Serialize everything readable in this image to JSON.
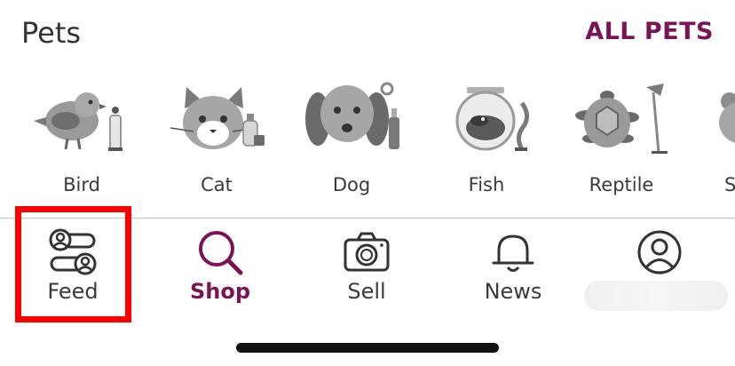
{
  "header": {
    "title": "Pets",
    "all_pets": "ALL PETS"
  },
  "categories": [
    {
      "label": "Bird",
      "icon": "bird-icon"
    },
    {
      "label": "Cat",
      "icon": "cat-icon"
    },
    {
      "label": "Dog",
      "icon": "dog-icon"
    },
    {
      "label": "Fish",
      "icon": "fish-icon"
    },
    {
      "label": "Reptile",
      "icon": "reptile-icon"
    },
    {
      "label": "Sm",
      "icon": "small-pet-icon"
    }
  ],
  "tabs": [
    {
      "label": "Feed",
      "icon": "feed-icon",
      "active": false
    },
    {
      "label": "Shop",
      "icon": "search-icon",
      "active": true
    },
    {
      "label": "Sell",
      "icon": "camera-icon",
      "active": false
    },
    {
      "label": "News",
      "icon": "bell-icon",
      "active": false
    },
    {
      "label": "",
      "icon": "profile-icon",
      "active": false
    }
  ],
  "colors": {
    "accent": "#7a1456",
    "highlight": "#ff0000",
    "icon_gray": "#8c8c8c"
  }
}
